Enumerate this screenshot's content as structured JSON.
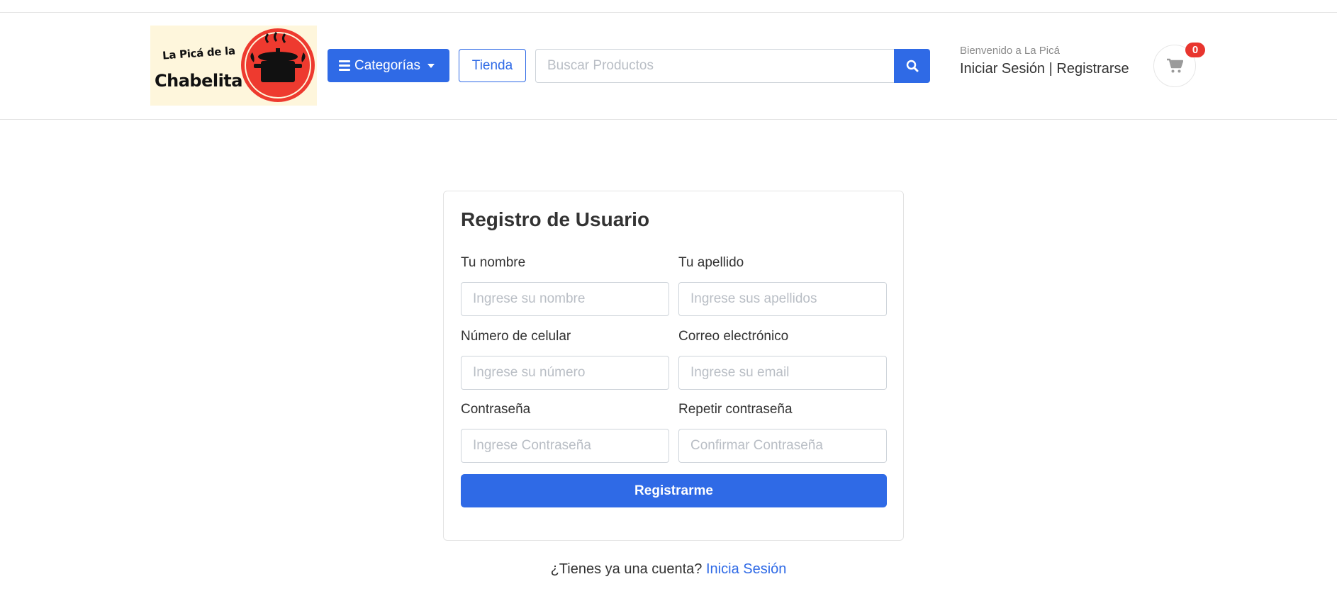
{
  "header": {
    "logo": {
      "line1": "La Picá de la",
      "line2": "Chabelita"
    },
    "categories_label": "Categorías",
    "tienda_label": "Tienda",
    "search": {
      "placeholder": "Buscar Productos",
      "value": ""
    },
    "welcome_text": "Bienvenido a La Picá",
    "login_label": "Iniciar Sesión",
    "separator": "|",
    "register_label": "Registrarse",
    "cart_count": "0"
  },
  "form": {
    "title": "Registro de Usuario",
    "fields": [
      {
        "label": "Tu nombre",
        "placeholder": "Ingrese su nombre"
      },
      {
        "label": "Tu apellido",
        "placeholder": "Ingrese sus apellidos"
      },
      {
        "label": "Número de celular",
        "placeholder": "Ingrese su número"
      },
      {
        "label": "Correo electrónico",
        "placeholder": "Ingrese su email"
      },
      {
        "label": "Contraseña",
        "placeholder": "Ingrese Contraseña"
      },
      {
        "label": "Repetir contraseña",
        "placeholder": "Confirmar Contraseña"
      }
    ],
    "submit_label": "Registrarme"
  },
  "footer": {
    "question": "¿Tienes ya una cuenta?",
    "login_link": "Inicia Sesión"
  },
  "colors": {
    "primary": "#2f6ae6",
    "badge": "#e8352e",
    "logo_bg": "#fef6dc",
    "logo_circle": "#ee3a2f"
  },
  "icons": [
    "bars-icon",
    "caret-down-icon",
    "search-icon",
    "cart-icon",
    "pot-icon"
  ]
}
